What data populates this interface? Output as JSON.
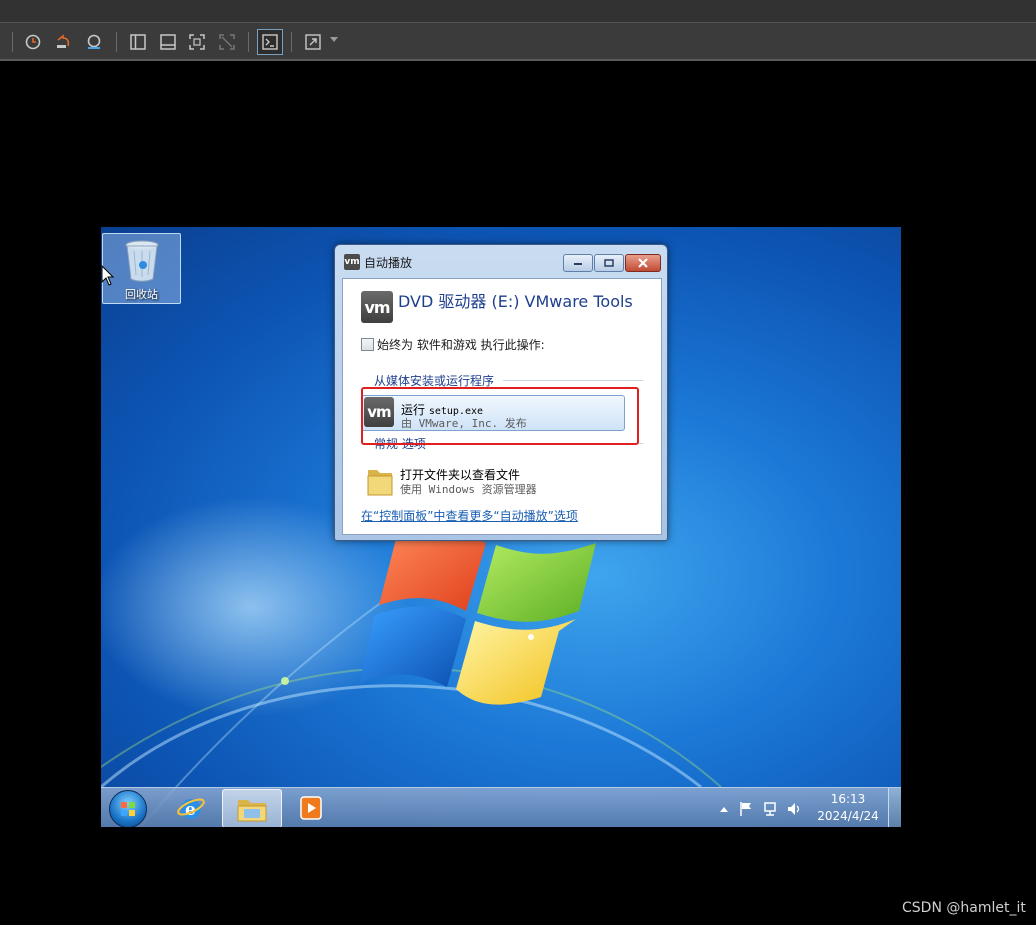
{
  "host_toolbar": {
    "icons": [
      "snapshot-icon",
      "revert-snapshot-icon",
      "snapshot-manager-icon",
      "sidebar-toggle-icon",
      "console-view-icon",
      "fullscreen-icon",
      "unity-icon",
      "terminal-icon",
      "stretch-icon"
    ]
  },
  "desktop": {
    "recycle_bin_label": "回收站"
  },
  "dialog": {
    "title": "自动播放",
    "logo_text": "vm",
    "heading": "DVD 驱动器 (E:) VMware Tools",
    "always_do_label": "始终为 软件和游戏 执行此操作:",
    "section_install": "从媒体安装或运行程序",
    "run_option": {
      "prefix": "运行 ",
      "file": "setup.exe",
      "publisher_prefix": "由 ",
      "publisher": "VMware, Inc.",
      "publisher_suffix": " 发布"
    },
    "section_general": "常规 选项",
    "open_folder_option": {
      "title": "打开文件夹以查看文件",
      "sub_prefix": "使用 ",
      "sub_mono": "Windows",
      "sub_suffix": " 资源管理器"
    },
    "control_panel_link": "在“控制面板”中查看更多“自动播放”选项",
    "highlight_color": "#e02020"
  },
  "taskbar": {
    "time": "16:13",
    "date": "2024/4/24",
    "tray_icons": [
      "show-hidden-icons-arrow",
      "action-center-flag-icon",
      "network-icon",
      "volume-icon"
    ]
  },
  "watermark": "CSDN @hamlet_it"
}
